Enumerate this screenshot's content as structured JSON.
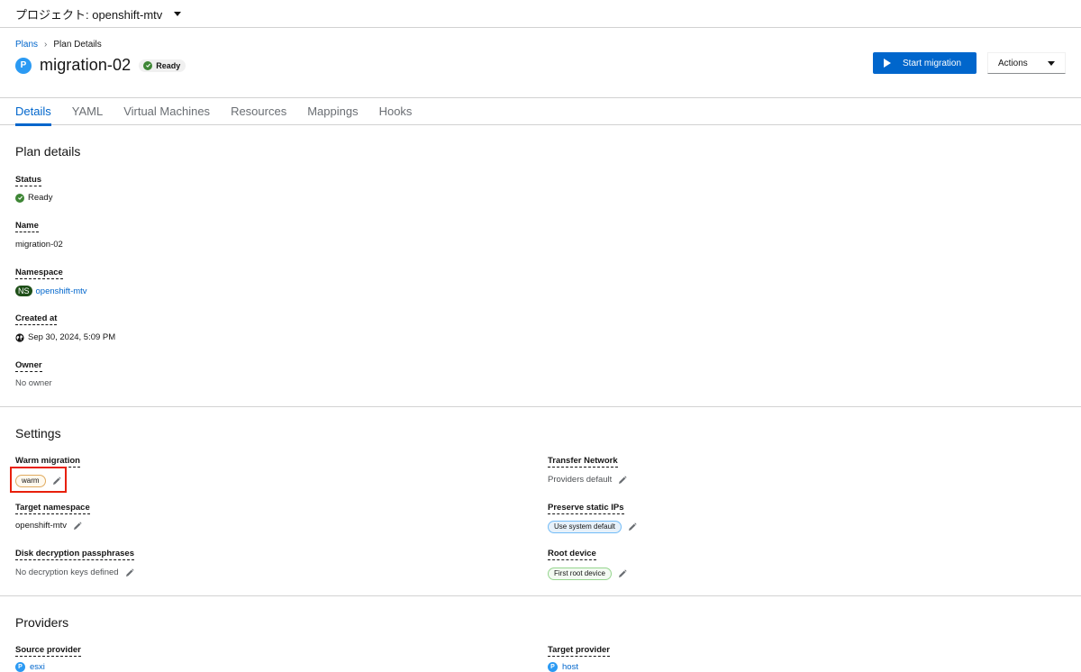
{
  "project": {
    "label": "プロジェクト: openshift-mtv"
  },
  "breadcrumb": {
    "root": "Plans",
    "current": "Plan Details"
  },
  "header": {
    "badge": "P",
    "title": "migration-02",
    "status": "Ready",
    "start_button": "Start migration",
    "actions_button": "Actions"
  },
  "tabs": [
    "Details",
    "YAML",
    "Virtual Machines",
    "Resources",
    "Mappings",
    "Hooks"
  ],
  "plan_details": {
    "title": "Plan details",
    "status_label": "Status",
    "status_value": "Ready",
    "name_label": "Name",
    "name_value": "migration-02",
    "namespace_label": "Namespace",
    "namespace_badge": "NS",
    "namespace_value": "openshift-mtv",
    "created_label": "Created at",
    "created_value": "Sep 30, 2024, 5:09 PM",
    "owner_label": "Owner",
    "owner_value": "No owner"
  },
  "settings": {
    "title": "Settings",
    "warm_label": "Warm migration",
    "warm_value": "warm",
    "transfer_label": "Transfer Network",
    "transfer_value": "Providers default",
    "target_ns_label": "Target namespace",
    "target_ns_value": "openshift-mtv",
    "static_ip_label": "Preserve static IPs",
    "static_ip_value": "Use system default",
    "disk_label": "Disk decryption passphrases",
    "disk_value": "No decryption keys defined",
    "root_label": "Root device",
    "root_value": "First root device"
  },
  "providers": {
    "title": "Providers",
    "source_label": "Source provider",
    "source_badge": "P",
    "source_value": "esxi",
    "target_label": "Target provider",
    "target_badge": "P",
    "target_value": "host"
  },
  "colors": {
    "primary": "#0066cc",
    "success": "#3e8635",
    "highlight": "#e8200b",
    "provider_badge": "#2b9af3"
  },
  "icons": {
    "caret": "chevron-down-icon",
    "play": "play-icon",
    "check": "check-circle-icon",
    "globe": "globe-icon",
    "edit": "pencil-icon"
  }
}
